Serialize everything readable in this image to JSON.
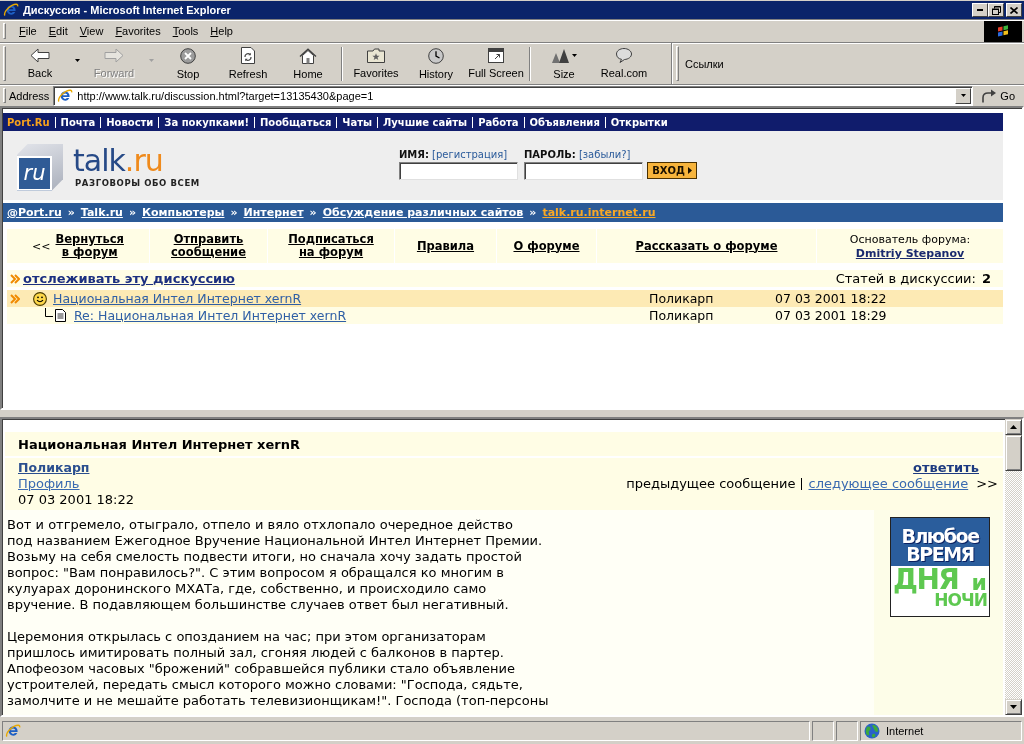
{
  "window": {
    "title": "Дискуссия - Microsoft Internet Explorer"
  },
  "menu": [
    "File",
    "Edit",
    "View",
    "Favorites",
    "Tools",
    "Help"
  ],
  "toolbar": {
    "groups": [
      [
        {
          "label": "Back",
          "kind": "split",
          "disabled": false
        },
        {
          "label": "Forward",
          "kind": "split",
          "disabled": true
        },
        {
          "label": "Stop",
          "kind": "plain",
          "disabled": false
        },
        {
          "label": "Refresh",
          "kind": "plain",
          "disabled": false
        },
        {
          "label": "Home",
          "kind": "plain",
          "disabled": false
        }
      ],
      [
        {
          "label": "Favorites",
          "kind": "plain",
          "disabled": false
        },
        {
          "label": "History",
          "kind": "plain",
          "disabled": false
        },
        {
          "label": "Full Screen",
          "kind": "plain",
          "disabled": false
        }
      ],
      [
        {
          "label": "Size",
          "kind": "menu",
          "disabled": false
        },
        {
          "label": "Real.com",
          "kind": "plain",
          "disabled": false
        }
      ]
    ],
    "links_label": "Ссылки"
  },
  "address_bar": {
    "label": "Address",
    "value": "http://www.talk.ru/discussion.html?target=13135430&page=1",
    "go": "Go"
  },
  "portal_nav": {
    "home": "Port.Ru",
    "links": [
      "Почта",
      "Новости",
      "За покупками!",
      "Пообщаться",
      "Чаты",
      "Лучшие сайты",
      "Работа",
      "Объявления",
      "Открытки"
    ]
  },
  "logo": {
    "badge": "ru",
    "name": "talk",
    "domain": ".ru",
    "tagline": "РАЗГОВОРЫ ОБО ВСЕМ"
  },
  "login": {
    "name_label": "ИМЯ:",
    "register_link": "[регистрация]",
    "password_label": "ПАРОЛЬ:",
    "forgot_link": "[забыли?]",
    "submit": "ВХОД"
  },
  "breadcrumb": [
    {
      "kind": "link",
      "text": "@Port.ru",
      "current": false
    },
    {
      "kind": "separator",
      "text": "»"
    },
    {
      "kind": "link",
      "text": "Talk.ru",
      "current": false
    },
    {
      "kind": "separator",
      "text": "»"
    },
    {
      "kind": "link",
      "text": "Компьютеры",
      "current": false
    },
    {
      "kind": "separator",
      "text": "»"
    },
    {
      "kind": "link",
      "text": "Интернет",
      "current": false
    },
    {
      "kind": "separator",
      "text": "»"
    },
    {
      "kind": "link",
      "text": "Обсуждение различных сайтов",
      "current": false
    },
    {
      "kind": "separator",
      "text": "»"
    },
    {
      "kind": "link",
      "text": "talk.ru.internet.ru",
      "current": true
    }
  ],
  "forum_nav": {
    "items": [
      {
        "prefix": "<<",
        "label": "Вернуться\nв форум"
      },
      {
        "label": "Отправить\nсообщение"
      },
      {
        "label": "Подписаться\nна форум"
      },
      {
        "label": "Правила"
      },
      {
        "label": "О форуме"
      },
      {
        "label": "Рассказать о форуме"
      }
    ],
    "founder": {
      "label": "Основатель форума:",
      "name": "Dmitriy Stepanov"
    }
  },
  "discussion": {
    "track_link": "отслеживать эту дискуссию",
    "count_label": "Статей в дискуссии:",
    "count": "2"
  },
  "threads": [
    {
      "title": "Национальная Интел Интернет xernR",
      "author": "Поликарп",
      "date": "07 03 2001 18:22",
      "selected": true,
      "children": [
        {
          "title": "Re: Национальная Интел Интернет xernR",
          "author": "Поликарп",
          "date": "07 03 2001 18:29",
          "selected": false
        }
      ]
    }
  ],
  "message": {
    "title": "Национальная Интел Интернет xernR",
    "author": "Поликарп",
    "profile_link": "Профиль",
    "date": "07 03 2001 18:22",
    "reply_link": "ответить",
    "previous": {
      "label": "предыдущее сообщение",
      "disabled": true
    },
    "next": {
      "label": "следующее сообщение",
      "disabled": false
    },
    "next_arrows": ">>",
    "paragraphs": [
      "Вот и отгремело, отыграло, отпело и вяло отхлопало очередное действо\nпод названием Ежегодное Вручение Национальной Интел Интернет Премии.\nВозьму на себя смелость подвести итоги, но сначала хочу задать простой\nвопрос: \"Вам понравилось?\". С этим вопросом я обращался ко многим в\nкулуарах доронинского МХАТа, где, собственно, и происходило само\nвручение. В подавляющем большинстве случаев ответ был негативный.",
      "Церемония открылась с опозданием на час; при этом организаторам\nпришлось имитировать полный зал, сгоняя людей с балконов в партер.\nАпофеозом часовых \"брожений\" собравшейся публики стало объявление\nустроителей, передать смысл которого можно словами: \"Господа, сядьте,\nзамолчите и не мешайте работать телевизионщикам!\". Господа (топ-персоны"
    ]
  },
  "banner": {
    "lines": [
      "Влюбое",
      "ВРЕМЯ",
      "ДНЯ",
      "и",
      "НОЧИ"
    ]
  },
  "status_bar": {
    "zone": "Internet"
  }
}
